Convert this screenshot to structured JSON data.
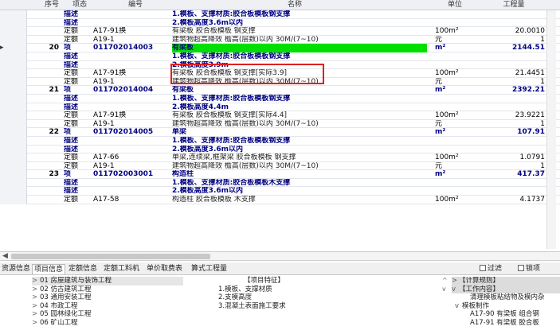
{
  "grid": {
    "headers": {
      "seq": "序号",
      "category": "项态",
      "code": "编号",
      "name": "名称",
      "unit": "单位",
      "quantity": "工程量"
    },
    "rows": [
      {
        "type": "desc",
        "no": "",
        "cat": "描述",
        "code": "",
        "name": "1.模板、支撑材质:胶合板模板钢支撑",
        "unit": "",
        "qty": ""
      },
      {
        "type": "desc",
        "no": "",
        "cat": "描述",
        "code": "",
        "name": "2.模板高度3.6m以内",
        "unit": "",
        "qty": ""
      },
      {
        "type": "quota",
        "no": "",
        "cat": "定额",
        "code": "A17-91换",
        "name": "有梁板 胶合板模板 钢支撑",
        "unit": "100m²",
        "qty": "20.0010"
      },
      {
        "type": "quota",
        "no": "",
        "cat": "定额",
        "code": "A19-1",
        "name": "建筑物超高降效 檐高(层数)以内 30M/(7~10)",
        "unit": "元",
        "qty": "1"
      },
      {
        "type": "item sel",
        "no": "20",
        "cat": "项",
        "code": "011702014003",
        "name": "有梁板",
        "unit": "m²",
        "qty": "2144.51"
      },
      {
        "type": "desc",
        "no": "",
        "cat": "描述",
        "code": "",
        "name": "1.模板、支撑材质:胶合板模板钢支撑",
        "unit": "",
        "qty": ""
      },
      {
        "type": "desc",
        "no": "",
        "cat": "描述",
        "code": "",
        "name": "2.模板高度3.9m",
        "unit": "",
        "qty": ""
      },
      {
        "type": "quota",
        "no": "",
        "cat": "定额",
        "code": "A17-91换",
        "name": "有梁板 胶合板模板 钢支撑[实际3.9]",
        "unit": "100m²",
        "qty": "21.4451"
      },
      {
        "type": "quota",
        "no": "",
        "cat": "定额",
        "code": "A19-1",
        "name": "建筑物超高降效 檐高(层数)以内 30M/(7~10)",
        "unit": "元",
        "qty": "1"
      },
      {
        "type": "item",
        "no": "21",
        "cat": "项",
        "code": "011702014004",
        "name": "有梁板",
        "unit": "m²",
        "qty": "2392.21"
      },
      {
        "type": "desc",
        "no": "",
        "cat": "描述",
        "code": "",
        "name": "1.模板、支撑材质:胶合板模板钢支撑",
        "unit": "",
        "qty": ""
      },
      {
        "type": "desc",
        "no": "",
        "cat": "描述",
        "code": "",
        "name": "2.模板高度4.4m",
        "unit": "",
        "qty": ""
      },
      {
        "type": "quota",
        "no": "",
        "cat": "定额",
        "code": "A17-91换",
        "name": "有梁板 胶合板模板 钢支撑[实际4.4]",
        "unit": "100m²",
        "qty": "23.9221"
      },
      {
        "type": "quota",
        "no": "",
        "cat": "定额",
        "code": "A19-1",
        "name": "建筑物超高降效 檐高(层数)以内 30M/(7~10)",
        "unit": "元",
        "qty": "1"
      },
      {
        "type": "item",
        "no": "22",
        "cat": "项",
        "code": "011702014005",
        "name": "单梁",
        "unit": "m²",
        "qty": "107.91"
      },
      {
        "type": "desc",
        "no": "",
        "cat": "描述",
        "code": "",
        "name": "1.模板、支撑材质:胶合板模板钢支撑",
        "unit": "",
        "qty": ""
      },
      {
        "type": "desc",
        "no": "",
        "cat": "描述",
        "code": "",
        "name": "2.模板高度3.6m以内",
        "unit": "",
        "qty": ""
      },
      {
        "type": "quota",
        "no": "",
        "cat": "定额",
        "code": "A17-66",
        "name": "单梁,连续梁,框架梁 胶合板模板 钢支撑",
        "unit": "100m²",
        "qty": "1.0791"
      },
      {
        "type": "quota",
        "no": "",
        "cat": "定额",
        "code": "A19-1",
        "name": "建筑物超高降效 檐高(层数)以内 30M/(7~10)",
        "unit": "元",
        "qty": "1"
      },
      {
        "type": "item",
        "no": "23",
        "cat": "项",
        "code": "011702003001",
        "name": "构造柱",
        "unit": "m²",
        "qty": "417.37"
      },
      {
        "type": "desc",
        "no": "",
        "cat": "描述",
        "code": "",
        "name": "1.模板、支撑材质:胶合板模板木支撑",
        "unit": "",
        "qty": ""
      },
      {
        "type": "desc",
        "no": "",
        "cat": "描述",
        "code": "",
        "name": "2.模板高度3.6m以内",
        "unit": "",
        "qty": ""
      },
      {
        "type": "quota",
        "no": "",
        "cat": "定额",
        "code": "A17-58",
        "name": "构造柱 胶合板模板 木支撑",
        "unit": "100m²",
        "qty": "4.1737"
      }
    ]
  },
  "tabs": {
    "items": [
      "资源信息",
      "项目信息",
      "定额信息",
      "定额工料机",
      "单价取费表",
      "算式工程量"
    ],
    "active": "项目信息",
    "filter_label": "过滤",
    "lock_label": "锁项"
  },
  "tree": [
    {
      "arrow": ">",
      "label": "01 房屋建筑与装饰工程"
    },
    {
      "arrow": ">",
      "label": "02 仿古建筑工程"
    },
    {
      "arrow": ">",
      "label": "03 通用安装工程"
    },
    {
      "arrow": ">",
      "label": "04 市政工程"
    },
    {
      "arrow": ">",
      "label": "05 园林绿化工程"
    },
    {
      "arrow": ">",
      "label": "06 矿山工程"
    }
  ],
  "features": {
    "header": "【项目特征】",
    "items": [
      "1.模板、支撑材质",
      "2.支模高度",
      "3.混凝土表面施工要求"
    ]
  },
  "rules": [
    {
      "arrow": ">",
      "label": "【计算规则】"
    },
    {
      "arrow": "v",
      "label": "【工作内容】"
    },
    {
      "arrow": "",
      "label": "清理模板粘结物及模内杂"
    },
    {
      "arrow": "v",
      "label": "模板制作"
    },
    {
      "arrow": "",
      "label": "A17-90 有梁板 组合钢"
    },
    {
      "arrow": "",
      "label": "A17-91 有梁板 胶合板"
    }
  ]
}
